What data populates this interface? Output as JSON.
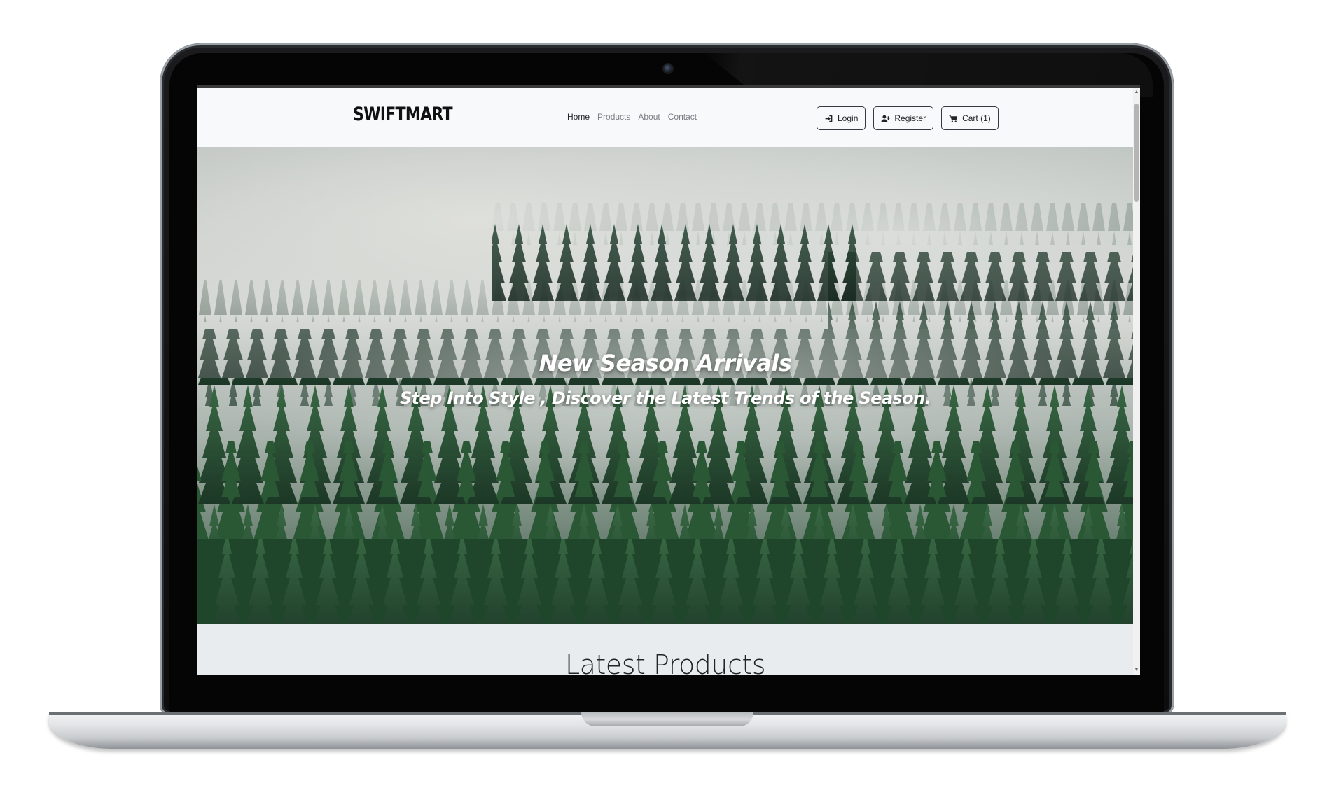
{
  "brand": {
    "name": "SWIFTMART"
  },
  "nav": {
    "links": [
      {
        "label": "Home",
        "active": true
      },
      {
        "label": "Products",
        "active": false
      },
      {
        "label": "About",
        "active": false
      },
      {
        "label": "Contact",
        "active": false
      }
    ],
    "actions": [
      {
        "label": "Login",
        "icon": "login-icon"
      },
      {
        "label": "Register",
        "icon": "user-plus-icon"
      },
      {
        "label": "Cart (1)",
        "icon": "cart-icon"
      }
    ]
  },
  "hero": {
    "title": "New Season Arrivals",
    "subtitle": "Step Into Style , Discover the Latest Trends of the Season.",
    "background": "misty-pine-forest"
  },
  "latest": {
    "title": "Latest Products"
  },
  "colors": {
    "navbar_bg": "#f8f9fa",
    "section_bg": "#e9ecef",
    "text_dark": "#212529",
    "nav_muted": "#7a7f85",
    "forest_dark": "#1f3a2c",
    "forest_mid": "#2f5a3f",
    "mist": "#e8ebe8"
  }
}
